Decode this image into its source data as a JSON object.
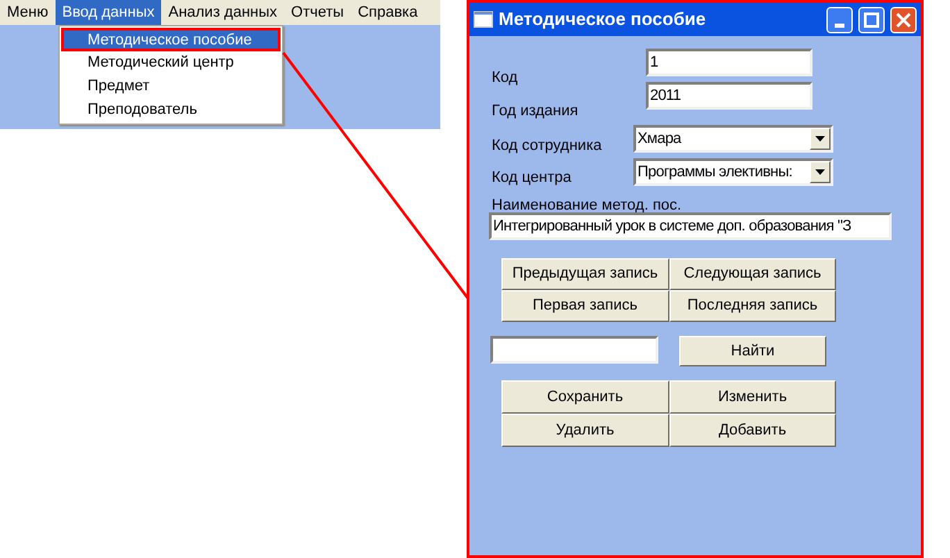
{
  "menu_bar": [
    {
      "label": "Меню",
      "selected": false
    },
    {
      "label": "Ввод данных",
      "selected": true
    },
    {
      "label": "Анализ данных",
      "selected": false
    },
    {
      "label": "Отчеты",
      "selected": false
    },
    {
      "label": "Справка",
      "selected": false
    }
  ],
  "dropdown": [
    {
      "label": "Методическое пособие",
      "selected": true
    },
    {
      "label": "Методический центр",
      "selected": false
    },
    {
      "label": "Предмет",
      "selected": false
    },
    {
      "label": "Преподователь",
      "selected": false
    }
  ],
  "window": {
    "title": "Методическое пособие",
    "fields": [
      {
        "kind": "text",
        "label": "Код",
        "value": "1"
      },
      {
        "kind": "text",
        "label": "Год издания",
        "value": "2011"
      },
      {
        "kind": "combo",
        "label": "Код сотрудника",
        "value": "Хмара"
      },
      {
        "kind": "combo",
        "label": "Код центра",
        "value": "Программы элективны:"
      }
    ],
    "name_field": {
      "label": "Наименование метод. пос.",
      "value": "Интегрированный урок в системе доп. образования \"З"
    },
    "nav_buttons": [
      "Предыдущая запись",
      "Следующая запись",
      "Первая запись",
      "Последняя запись"
    ],
    "search_button": "Найти",
    "action_buttons": [
      "Сохранить",
      "Изменить",
      "Удалить",
      "Добавить"
    ]
  }
}
